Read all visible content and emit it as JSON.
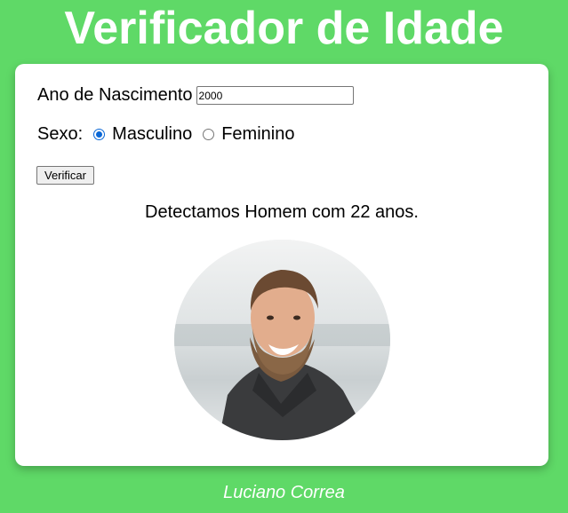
{
  "header": {
    "title": "Verificador de Idade"
  },
  "form": {
    "year_label": "Ano de Nascimento",
    "year_value": "2000",
    "sex_label": "Sexo:",
    "options": [
      {
        "label": "Masculino",
        "checked": true
      },
      {
        "label": "Feminino",
        "checked": false
      }
    ],
    "button_label": "Verificar"
  },
  "result": {
    "text": "Detectamos Homem com 22 anos."
  },
  "photo": {
    "icon": "man-portrait-photo"
  },
  "footer": {
    "author": "Luciano Correa"
  },
  "colors": {
    "background": "#5fd967",
    "card": "#ffffff",
    "radio_accent": "#0a67d6"
  }
}
